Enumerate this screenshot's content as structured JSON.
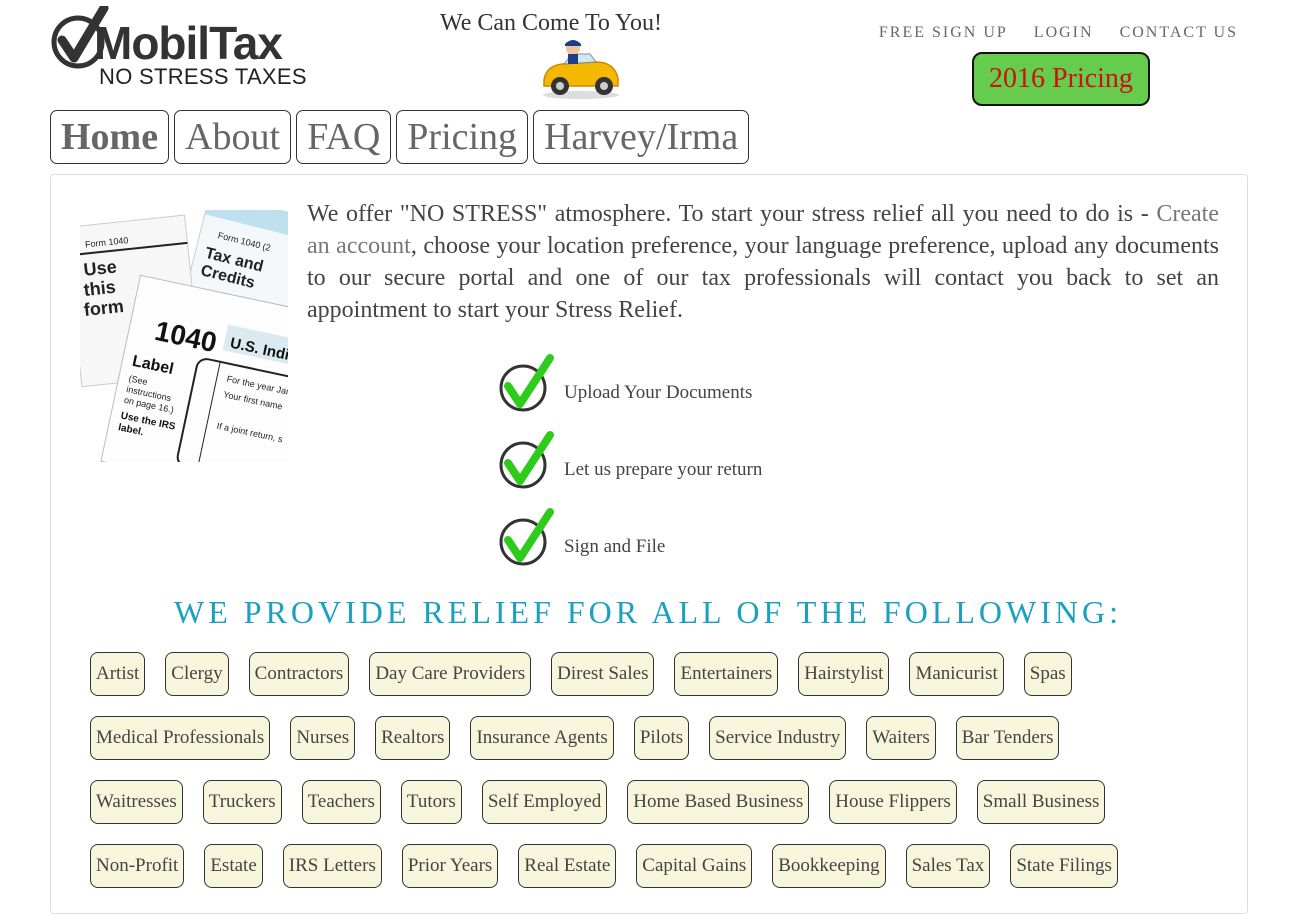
{
  "logo": {
    "brand": "MobilTax",
    "tagline": "NO STRESS TAXES"
  },
  "header": {
    "slogan": "We Can Come To You!",
    "nav": [
      "FREE SIGN UP",
      "LOGIN",
      "CONTACT US"
    ],
    "pricing_button": "2016 Pricing"
  },
  "tabs": [
    "Home",
    "About",
    "FAQ",
    "Pricing",
    "Harvey/Irma"
  ],
  "intro": {
    "before_link": "We offer \"NO STRESS\" atmosphere. To start your stress relief all you need to do is - ",
    "link": "Create an account",
    "after_link": ", choose your location preference, your language preference, upload any documents to our secure portal and one of our tax professionals will contact you back to set an appointment to start your Stress Relief."
  },
  "steps": [
    "Upload Your Documents",
    "Let us prepare your return",
    "Sign and File"
  ],
  "relief_title": "WE PROVIDE RELIEF FOR ALL OF THE FOLLOWING:",
  "categories": [
    [
      "Artist",
      "Clergy",
      "Contractors",
      "Day Care Providers",
      "Direst Sales",
      "Entertainers",
      "Hairstylist",
      "Manicurist",
      "Spas"
    ],
    [
      "Medical Professionals",
      "Nurses",
      "Realtors",
      "Insurance Agents",
      "Pilots",
      "Service Industry",
      "Waiters",
      "Bar Tenders"
    ],
    [
      "Waitresses",
      "Truckers",
      "Teachers",
      "Tutors",
      "Self Employed",
      "Home Based Business",
      "House Flippers",
      "Small Business"
    ],
    [
      "Non-Profit",
      "Estate",
      "IRS Letters",
      "Prior Years",
      "Real Estate",
      "Capital Gains",
      "Bookkeeping",
      "Sales Tax",
      "State Filings"
    ]
  ],
  "colors": {
    "pricing_bg": "#66cc4d",
    "pricing_text": "#cc1111",
    "relief_title": "#1aa0c0",
    "chip_bg": "#f7f6dc",
    "check": "#2ecc1a"
  }
}
